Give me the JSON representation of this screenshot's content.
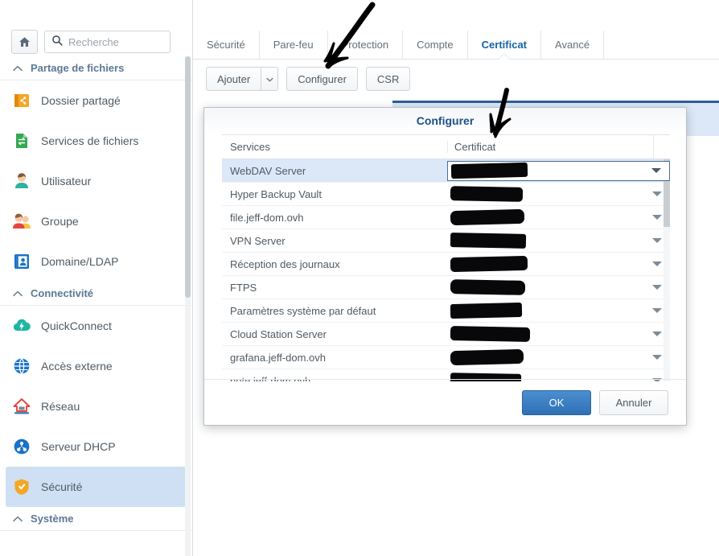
{
  "sidebar": {
    "home_icon": "home-icon",
    "search": {
      "icon": "search-icon",
      "placeholder": "Recherche",
      "value": ""
    },
    "sections": [
      {
        "id": "partage-de-fichiers",
        "label": "Partage de fichiers",
        "chevron": "chevron-up-icon",
        "items": [
          {
            "id": "dossier-partage",
            "label": "Dossier partagé",
            "icon": "shared-folder-icon"
          },
          {
            "id": "services-de-fichiers",
            "label": "Services de fichiers",
            "icon": "file-services-icon"
          },
          {
            "id": "utilisateur",
            "label": "Utilisateur",
            "icon": "user-icon"
          },
          {
            "id": "groupe",
            "label": "Groupe",
            "icon": "group-icon"
          },
          {
            "id": "domaine-ldap",
            "label": "Domaine/LDAP",
            "icon": "domain-ldap-icon"
          }
        ]
      },
      {
        "id": "connectivite",
        "label": "Connectivité",
        "chevron": "chevron-up-icon",
        "items": [
          {
            "id": "quickconnect",
            "label": "QuickConnect",
            "icon": "quickconnect-icon"
          },
          {
            "id": "acces-externe",
            "label": "Accès externe",
            "icon": "external-access-icon"
          },
          {
            "id": "reseau",
            "label": "Réseau",
            "icon": "network-icon"
          },
          {
            "id": "serveur-dhcp",
            "label": "Serveur DHCP",
            "icon": "dhcp-server-icon"
          },
          {
            "id": "securite",
            "label": "Sécurité",
            "icon": "shield-icon",
            "active": true
          }
        ]
      },
      {
        "id": "systeme",
        "label": "Système",
        "chevron": "chevron-up-icon",
        "items": []
      }
    ]
  },
  "main": {
    "tabs": [
      {
        "id": "securite",
        "label": "Sécurité",
        "active": false
      },
      {
        "id": "pare-feu",
        "label": "Pare-feu",
        "active": false
      },
      {
        "id": "protection",
        "label": "Protection",
        "active": false
      },
      {
        "id": "compte",
        "label": "Compte",
        "active": false
      },
      {
        "id": "certificat",
        "label": "Certificat",
        "active": true
      },
      {
        "id": "avance",
        "label": "Avancé",
        "active": false
      }
    ],
    "toolbar": {
      "add_label": "Ajouter",
      "add_caret_icon": "chevron-down-icon",
      "configure_label": "Configurer",
      "csr_label": "CSR"
    }
  },
  "dialog": {
    "title": "Configurer",
    "table": {
      "columns": [
        "Services",
        "Certificat"
      ],
      "kebab_icon": "kebab-menu-icon",
      "rows": [
        {
          "service": "WebDAV Server",
          "certificate": "",
          "redacted": true,
          "redact_width": 95,
          "selected": true
        },
        {
          "service": "Hyper Backup Vault",
          "certificate": "",
          "redacted": true,
          "redact_width": 90,
          "selected": false
        },
        {
          "service": "file.jeff-dom.ovh",
          "certificate": "",
          "redacted": true,
          "redact_width": 92,
          "selected": false
        },
        {
          "service": "VPN Server",
          "certificate": "",
          "redacted": true,
          "redact_width": 94,
          "selected": false
        },
        {
          "service": "Réception des journaux",
          "certificate": "",
          "redacted": true,
          "redact_width": 96,
          "selected": false
        },
        {
          "service": "FTPS",
          "certificate": "",
          "redacted": true,
          "redact_width": 93,
          "selected": false
        },
        {
          "service": "Paramètres système par défaut",
          "certificate": "",
          "redacted": true,
          "redact_width": 89,
          "selected": false
        },
        {
          "service": "Cloud Station Server",
          "certificate": "",
          "redacted": true,
          "redact_width": 99,
          "selected": false
        },
        {
          "service": "grafana.jeff-dom.ovh",
          "certificate": "",
          "redacted": true,
          "redact_width": 91,
          "selected": false
        },
        {
          "service": "note.jeff-dom.ovh",
          "certificate": "",
          "redacted": true,
          "redact_width": 88,
          "selected": false
        }
      ]
    },
    "ok_label": "OK",
    "cancel_label": "Annuler"
  },
  "annotations": [
    {
      "id": "arrow-to-configurer",
      "type": "hand-drawn-arrow",
      "color": "#000000",
      "points_to": "Configurer"
    },
    {
      "id": "arrow-to-certificat",
      "type": "hand-drawn-arrow",
      "color": "#000000",
      "points_to": "Certificat"
    }
  ],
  "colors": {
    "accent_blue": "#1464a5",
    "selected_row": "#dce8f7",
    "dialog_title": "#1f4e87",
    "ok_button": "#2f70b5",
    "redaction": "#08080a"
  }
}
